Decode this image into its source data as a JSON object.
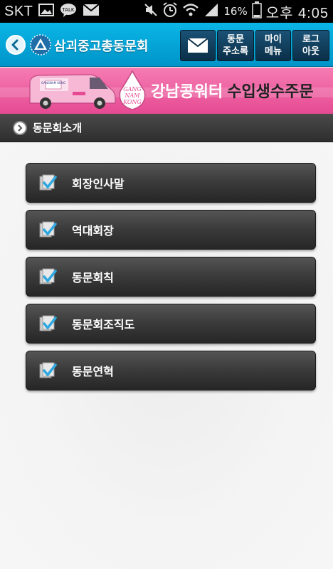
{
  "status_bar": {
    "carrier": "SKT",
    "battery_percent": "16%",
    "time": "오후 4:05",
    "icons": [
      "image-icon",
      "talk-icon",
      "mail-icon",
      "mute-icon",
      "alarm-icon",
      "wifi-icon",
      "signal-icon",
      "battery-icon"
    ]
  },
  "header": {
    "title": "삼괴중고총동문회",
    "buttons": {
      "mail_icon": "mail-icon",
      "address_book": [
        "동문",
        "주소록"
      ],
      "my_menu": [
        "마이",
        "메뉴"
      ],
      "logout": [
        "로그",
        "아웃"
      ]
    }
  },
  "banner": {
    "brand_lines": [
      "GANG",
      "NAM",
      "KONG"
    ],
    "van_label": "GANGNAM KONG",
    "text_pink": "강남콩워터",
    "text_dark": "수입생수주문"
  },
  "section": {
    "title": "동문회소개"
  },
  "menu": {
    "items": [
      {
        "label": "회장인사말"
      },
      {
        "label": "역대회장"
      },
      {
        "label": "동문회칙"
      },
      {
        "label": "동문회조직도"
      },
      {
        "label": "동문연혁"
      }
    ]
  },
  "colors": {
    "header": "#0aa8dc",
    "banner": "#ee5fa2",
    "menu_button": "#3a3a3a",
    "check_accent": "#2fa8e0"
  }
}
